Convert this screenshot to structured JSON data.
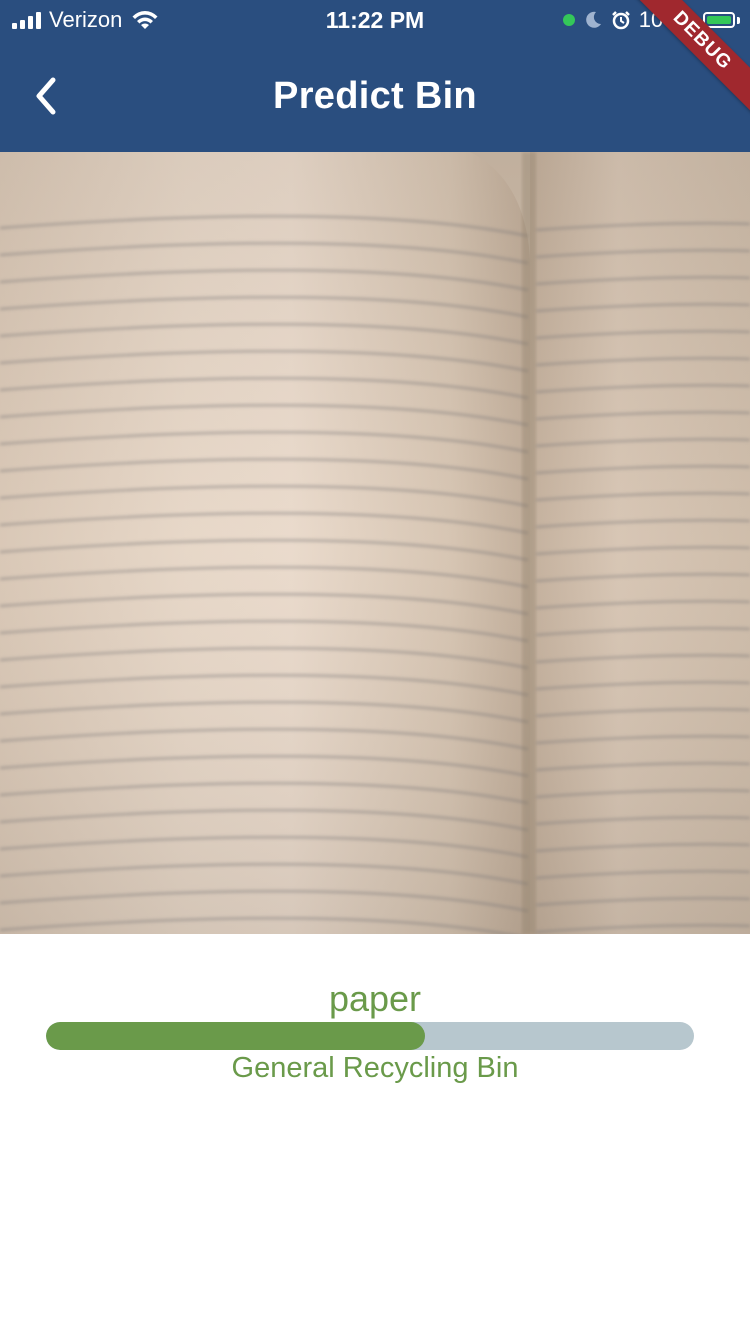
{
  "status_bar": {
    "carrier": "Verizon",
    "time": "11:22 PM",
    "battery_percent": "100%",
    "icons": [
      "signal-icon",
      "wifi-icon",
      "green-dot-icon",
      "moon-icon",
      "alarm-icon",
      "battery-charging-icon"
    ]
  },
  "app_bar": {
    "title": "Predict Bin",
    "back_icon": "chevron-left-icon",
    "debug_banner": "DEBUG"
  },
  "photo": {
    "description_icon": "captured-photo"
  },
  "result": {
    "predicted_class": "paper",
    "confidence": 0.585,
    "bin_label": "General Recycling Bin"
  },
  "colors": {
    "app_bar": "#2a4e7f",
    "accent_green": "#6a9a4a",
    "bar_track": "#b7c7ce",
    "debug_ribbon": "#a0282e"
  }
}
